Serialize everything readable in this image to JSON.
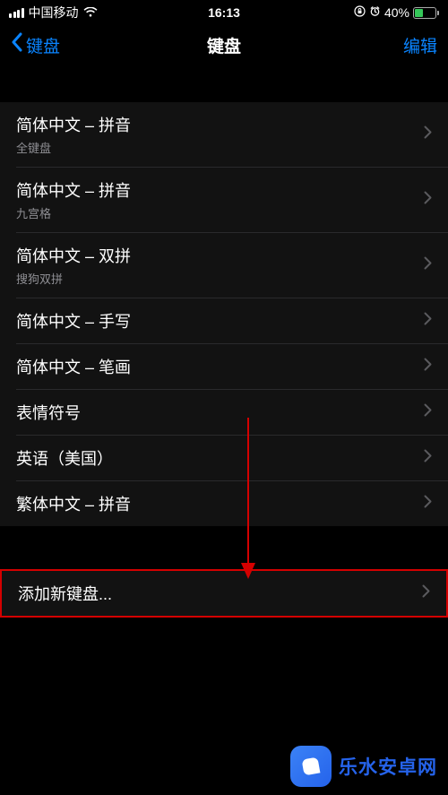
{
  "status": {
    "carrier": "中国移动",
    "time": "16:13",
    "battery_pct": "40%"
  },
  "nav": {
    "back_label": "键盘",
    "title": "键盘",
    "edit_label": "编辑"
  },
  "keyboards": [
    {
      "title": "简体中文 – 拼音",
      "subtitle": "全键盘"
    },
    {
      "title": "简体中文 – 拼音",
      "subtitle": "九宫格"
    },
    {
      "title": "简体中文 – 双拼",
      "subtitle": "搜狗双拼"
    },
    {
      "title": "简体中文 – 手写",
      "subtitle": ""
    },
    {
      "title": "简体中文 – 笔画",
      "subtitle": ""
    },
    {
      "title": "表情符号",
      "subtitle": ""
    },
    {
      "title": "英语（美国）",
      "subtitle": ""
    },
    {
      "title": "繁体中文 – 拼音",
      "subtitle": ""
    }
  ],
  "add": {
    "label": "添加新键盘..."
  },
  "watermark": {
    "text": "乐水安卓网"
  }
}
